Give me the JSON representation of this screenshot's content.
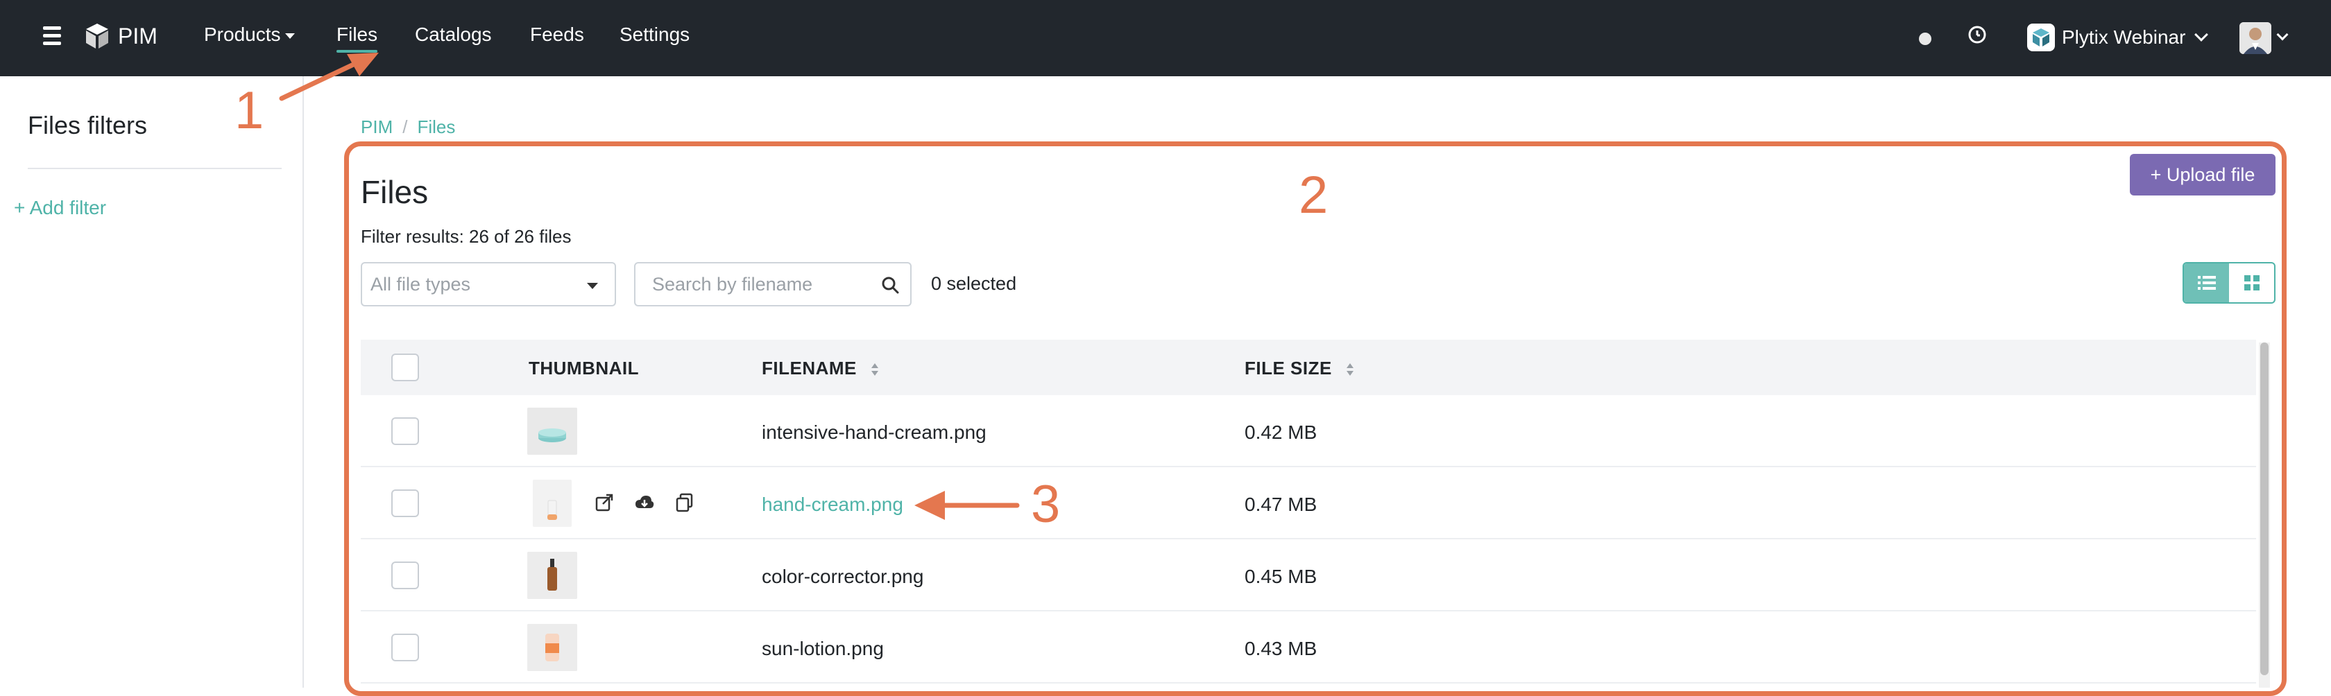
{
  "nav": {
    "brand": "PIM",
    "items": [
      {
        "label": "Products",
        "has_dropdown": true
      },
      {
        "label": "Files",
        "active": true
      },
      {
        "label": "Catalogs"
      },
      {
        "label": "Feeds"
      },
      {
        "label": "Settings"
      }
    ],
    "account_name": "Plytix Webinar",
    "icons": [
      "hamburger-icon",
      "cube-icon",
      "clock-icon",
      "user-avatar"
    ]
  },
  "sidebar": {
    "title": "Files filters",
    "add_filter": "+ Add filter"
  },
  "breadcrumb": [
    "PIM",
    "Files"
  ],
  "breadcrumb_sep": "/",
  "main": {
    "title": "Files",
    "filter_results": "Filter results: 26 of 26 files",
    "upload_button": "+ Upload file",
    "file_type_placeholder": "All file types",
    "search_placeholder": "Search by filename",
    "selected": "0 selected"
  },
  "table": {
    "columns": [
      "THUMBNAIL",
      "FILENAME",
      "FILE SIZE"
    ],
    "rows": [
      {
        "filename": "intensive-hand-cream.png",
        "size": "0.42 MB",
        "thumb": "teal-jar"
      },
      {
        "filename": "hand-cream.png",
        "size": "0.47 MB",
        "thumb": "orange-tube",
        "hovered": true
      },
      {
        "filename": "color-corrector.png",
        "size": "0.45 MB",
        "thumb": "amber-dropper"
      },
      {
        "filename": "sun-lotion.png",
        "size": "0.43 MB",
        "thumb": "orange-bottle"
      }
    ]
  },
  "annotations": [
    "1",
    "2",
    "3"
  ],
  "colors": {
    "navbar": "#22272d",
    "accent": "#4fb3a8",
    "upload": "#7b6ab2",
    "annotation": "#e4774f"
  }
}
